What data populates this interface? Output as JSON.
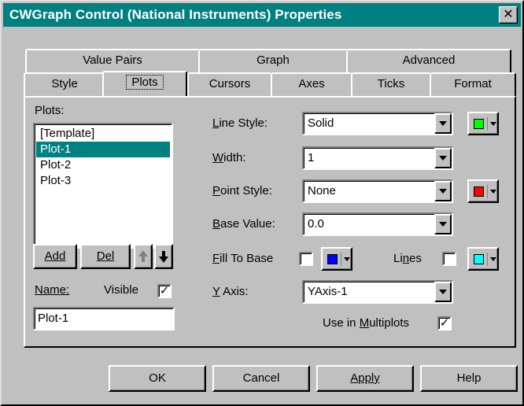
{
  "window": {
    "title": "CWGraph Control  (National Instruments) Properties",
    "close_label": "✕"
  },
  "tabs_back": [
    {
      "label": "Value Pairs"
    },
    {
      "label": "Graph"
    },
    {
      "label": "Advanced"
    }
  ],
  "tabs_front": [
    {
      "label": "Style"
    },
    {
      "label": "Plots",
      "active": true
    },
    {
      "label": "Cursors"
    },
    {
      "label": "Axes"
    },
    {
      "label": "Ticks"
    },
    {
      "label": "Format"
    }
  ],
  "plots": {
    "label": "Plots:",
    "items": [
      "[Template]",
      "Plot-1",
      "Plot-2",
      "Plot-3"
    ],
    "selected": "Plot-1",
    "add_label": "Add",
    "del_label": "Del",
    "name_label": "Name:",
    "name_value": "Plot-1",
    "visible_label": "Visible",
    "visible_checked": "✓"
  },
  "fields": {
    "line_style": {
      "label": "Line Style:",
      "value": "Solid",
      "color": "#00ff00"
    },
    "width": {
      "label": "Width:",
      "value": "1"
    },
    "point_style": {
      "label": "Point Style:",
      "value": "None",
      "color": "#ff0000"
    },
    "base_value": {
      "label": "Base Value:",
      "value": "0.0"
    },
    "fill_to_base": {
      "label": "Fill To Base",
      "checked": "",
      "color": "#0000ff"
    },
    "lines": {
      "label": "Lines",
      "checked": "",
      "color": "#00ffff"
    },
    "y_axis": {
      "label": "Y Axis:",
      "value": "YAxis-1"
    },
    "use_in_multiplots": {
      "label": "Use in Multiplots",
      "checked": "✓"
    }
  },
  "footer": {
    "ok": "OK",
    "cancel": "Cancel",
    "apply": "Apply",
    "help": "Help"
  },
  "icons": {
    "up": "up-arrow-icon",
    "down": "down-arrow-icon",
    "dropdown": "chevron-down-icon"
  }
}
